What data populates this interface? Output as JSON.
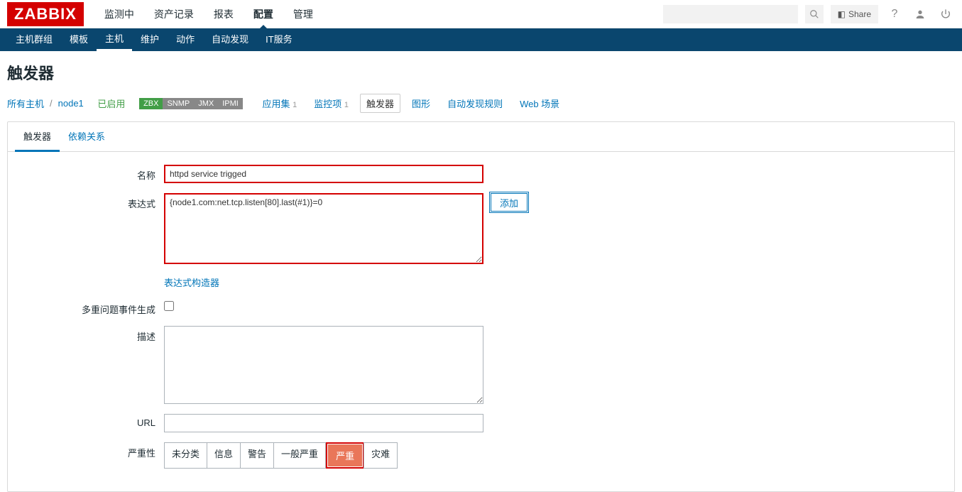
{
  "logo": "ZABBIX",
  "top_nav": [
    "监测中",
    "资产记录",
    "报表",
    "配置",
    "管理"
  ],
  "top_nav_active_index": 3,
  "share_label": "Share",
  "sub_nav": [
    "主机群组",
    "模板",
    "主机",
    "维护",
    "动作",
    "自动发现",
    "IT服务"
  ],
  "sub_nav_active_index": 2,
  "page_title": "触发器",
  "breadcrumb": {
    "all_hosts": "所有主机",
    "host": "node1",
    "enabled": "已启用",
    "badges": [
      "ZBX",
      "SNMP",
      "JMX",
      "IPMI"
    ],
    "apps": {
      "label": "应用集",
      "count": "1"
    },
    "items": {
      "label": "监控项",
      "count": "1"
    },
    "triggers": "触发器",
    "graphs": "图形",
    "discovery": "自动发现规则",
    "web": "Web 场景"
  },
  "tabs": {
    "trigger": "触发器",
    "deps": "依赖关系"
  },
  "form": {
    "name_label": "名称",
    "name_value": "httpd service trigged",
    "expr_label": "表达式",
    "expr_value": "{node1.com:net.tcp.listen[80].last(#1)}=0",
    "add_btn": "添加",
    "expr_constructor": "表达式构造器",
    "multi_label": "多重问题事件生成",
    "desc_label": "描述",
    "url_label": "URL",
    "url_value": "",
    "severity_label": "严重性",
    "severities": [
      "未分类",
      "信息",
      "警告",
      "一般严重",
      "严重",
      "灾难"
    ],
    "severity_selected_index": 4
  }
}
